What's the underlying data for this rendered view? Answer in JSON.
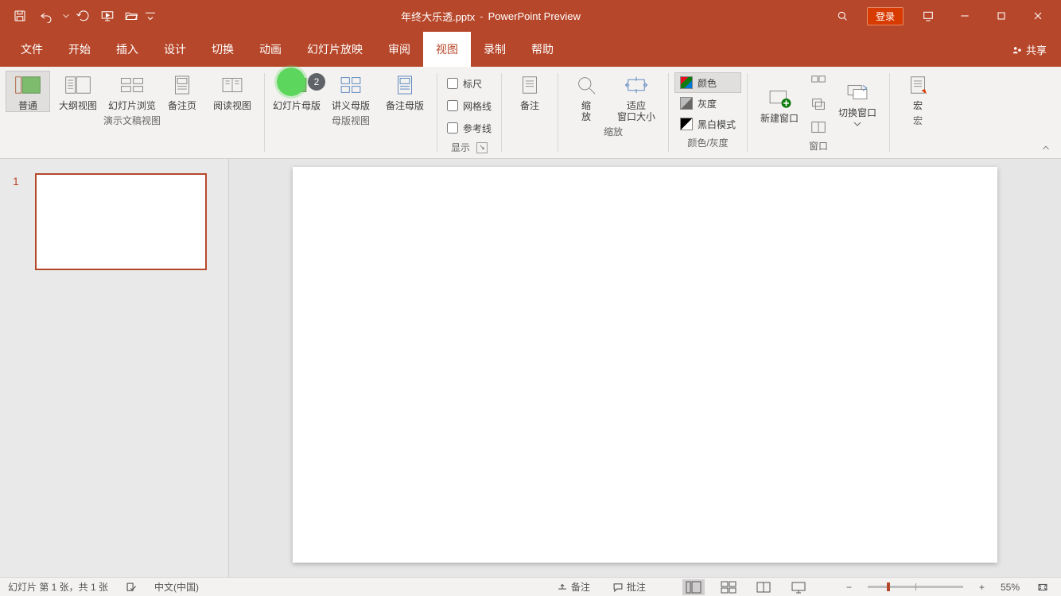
{
  "title": {
    "doc": "年终大乐透.pptx",
    "app": "PowerPoint Preview"
  },
  "qat": {
    "save": "保存",
    "undo": "撤销",
    "redo": "重做",
    "slideshow": "从头开始",
    "open": "打开"
  },
  "login_label": "登录",
  "share_label": "共享",
  "tabs": {
    "file": "文件",
    "home": "开始",
    "insert": "插入",
    "design": "设计",
    "transitions": "切换",
    "animations": "动画",
    "slideshow": "幻灯片放映",
    "review": "审阅",
    "view": "视图",
    "record": "录制",
    "help": "帮助"
  },
  "ribbon": {
    "presentation_views": {
      "normal": "普通",
      "outline": "大纲视图",
      "sorter": "幻灯片浏览",
      "notes_page": "备注页",
      "reading": "阅读视图",
      "group_label": "演示文稿视图"
    },
    "master_views": {
      "slide_master": "幻灯片母版",
      "handout_master": "讲义母版",
      "notes_master": "备注母版",
      "group_label": "母版视图"
    },
    "show": {
      "ruler": "标尺",
      "gridlines": "网格线",
      "guides": "参考线",
      "group_label": "显示"
    },
    "notes_btn": "备注",
    "zoom": {
      "zoom": "缩\n放",
      "fit": "适应\n窗口大小",
      "group_label": "缩放"
    },
    "color_gray": {
      "color": "颜色",
      "gray": "灰度",
      "bw": "黑白模式",
      "group_label": "颜色/灰度"
    },
    "window": {
      "new_window": "新建窗口",
      "switch_window": "切换窗口",
      "group_label": "窗口"
    },
    "macros": {
      "macros": "宏",
      "group_label": "宏"
    }
  },
  "tutorial_badge": "2",
  "thumbs": {
    "slide1_number": "1"
  },
  "statusbar": {
    "slide_counter": "幻灯片 第 1 张，共 1 张",
    "language": "中文(中国)",
    "notes": "备注",
    "comments": "批注",
    "zoom_pct": "55%"
  }
}
